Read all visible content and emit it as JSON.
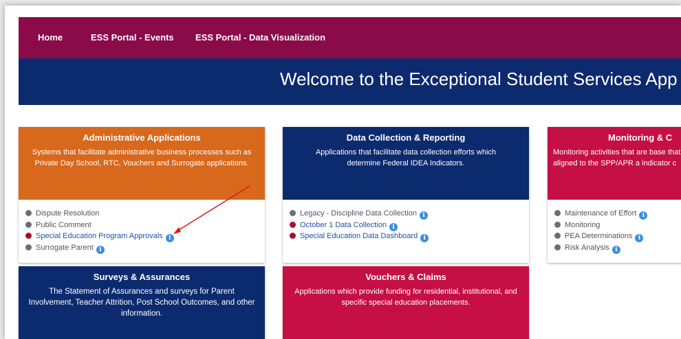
{
  "nav": {
    "items": [
      "Home",
      "ESS Portal - Events",
      "ESS Portal - Data Visualization"
    ],
    "bg": "#8b0a4a"
  },
  "hero": {
    "title": "Welcome to the Exceptional Student Services App",
    "bg": "#0c2a6e"
  },
  "cards": {
    "admin": {
      "title": "Administrative Applications",
      "desc": "Systems that facilitate administrative business processes such as Private Day School, RTC, Vouchers and Surrogate applications.",
      "color": "#d8681c",
      "items": [
        {
          "label": "Dispute Resolution",
          "dot": "gray",
          "link": false,
          "info": false
        },
        {
          "label": "Public Comment",
          "dot": "gray",
          "link": false,
          "info": false
        },
        {
          "label": "Special Education Program Approvals",
          "dot": "red",
          "link": true,
          "info": true
        },
        {
          "label": "Surrogate Parent",
          "dot": "gray",
          "link": false,
          "info": true
        }
      ]
    },
    "data": {
      "title": "Data Collection & Reporting",
      "desc": "Applications that facilitate data collection efforts which determine Federal IDEA Indicators.",
      "color": "#0c2a6e",
      "items": [
        {
          "label": "Legacy - Discipline Data Collection",
          "dot": "gray",
          "link": false,
          "info": true
        },
        {
          "label": "October 1 Data Collection",
          "dot": "red",
          "link": true,
          "info": true
        },
        {
          "label": "Special Education Data Dashboard",
          "dot": "red",
          "link": true,
          "info": true
        }
      ]
    },
    "monitoring": {
      "title": "Monitoring & C",
      "desc": "Monitoring activities that are base that are aligned to the SPP/APR a indicator c",
      "color": "#c50f45",
      "items": [
        {
          "label": "Maintenance of Effort",
          "dot": "gray",
          "link": false,
          "info": true
        },
        {
          "label": "Monitoring",
          "dot": "gray",
          "link": false,
          "info": false
        },
        {
          "label": "PEA Determinations",
          "dot": "gray",
          "link": false,
          "info": true
        },
        {
          "label": "Risk Analysis",
          "dot": "gray",
          "link": false,
          "info": true
        }
      ]
    },
    "surveys": {
      "title": "Surveys & Assurances",
      "desc": "The Statement of Assurances and surveys for Parent Involvement, Teacher Attrition, Post School Outcomes, and other information.",
      "color": "#0c2a6e"
    },
    "vouchers": {
      "title": "Vouchers & Claims",
      "desc": "Applications which provide funding for residential, institutional, and specific special education placements.",
      "color": "#c50f45"
    }
  },
  "icons": {
    "info": "info-icon",
    "status": "status-dot-icon",
    "annotation": "red-arrow-annotation"
  }
}
